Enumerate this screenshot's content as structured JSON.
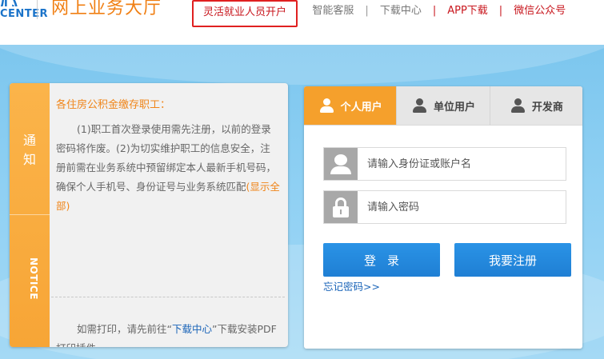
{
  "header": {
    "logo_glyph": "心",
    "logo_text": "CENTER",
    "brand": "网上业务大厅",
    "nav": [
      {
        "label": "灵活就业人员开户"
      },
      {
        "label": "智能客服"
      },
      {
        "label": "下载中心"
      },
      {
        "label": "APP下载"
      },
      {
        "label": "微信公众号"
      }
    ],
    "separators": [
      "|",
      "|",
      "|",
      "|"
    ]
  },
  "notice": {
    "tab_cn": "通知",
    "tab_en": "NOTICE",
    "title": "各住房公积金缴存职工：",
    "body": "(1)职工首次登录使用需先注册，以前的登录密码将作废。(2)为切实维护职工的信息安全，注册前需在业务系统中预留绑定本人最新手机号码，确保个人手机号、身份证号与业务系统匹配",
    "show_all": "(显示全部)",
    "print_before": "如需打印，请先前往“",
    "print_link": "下载中心",
    "print_after": "”下载安装PDF打印插件。"
  },
  "login": {
    "tabs": [
      {
        "label": "个人用户",
        "active": true
      },
      {
        "label": "单位用户",
        "active": false
      },
      {
        "label": "开发商",
        "active": false
      }
    ],
    "username_placeholder": "请输入身份证或账户名",
    "password_placeholder": "请输入密码",
    "login_button": "登录",
    "register_button": "我要注册",
    "forgot": "忘记密码>>"
  },
  "colors": {
    "accent_orange": "#f5a02c",
    "nav_red": "#c8161d",
    "button_blue": "#1f7fd4",
    "link_blue": "#1a64b8",
    "banner_blue": "#8fd0f3"
  }
}
